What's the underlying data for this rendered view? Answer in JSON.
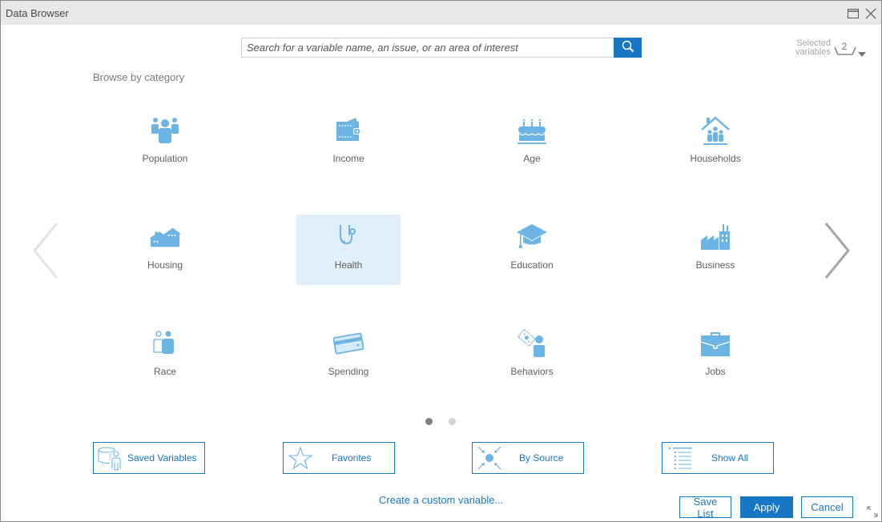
{
  "window": {
    "title": "Data Browser"
  },
  "search": {
    "placeholder": "Search for a variable name, an issue, or an area of interest",
    "value": "",
    "button_icon": "search-icon"
  },
  "selected_variables": {
    "label_line1": "Selected",
    "label_line2": "variables",
    "count": "2"
  },
  "browse": {
    "label": "Browse by category",
    "categories": [
      {
        "label": "Population",
        "icon": "population-icon",
        "selected": false
      },
      {
        "label": "Income",
        "icon": "wallet-icon",
        "selected": false
      },
      {
        "label": "Age",
        "icon": "birthday-cake-icon",
        "selected": false
      },
      {
        "label": "Households",
        "icon": "household-icon",
        "selected": false
      },
      {
        "label": "Housing",
        "icon": "house-icon",
        "selected": false
      },
      {
        "label": "Health",
        "icon": "stethoscope-icon",
        "selected": true
      },
      {
        "label": "Education",
        "icon": "graduation-cap-icon",
        "selected": false
      },
      {
        "label": "Business",
        "icon": "factory-icon",
        "selected": false
      },
      {
        "label": "Race",
        "icon": "people-icon",
        "selected": false
      },
      {
        "label": "Spending",
        "icon": "credit-card-icon",
        "selected": false
      },
      {
        "label": "Behaviors",
        "icon": "behavior-icon",
        "selected": false
      },
      {
        "label": "Jobs",
        "icon": "briefcase-icon",
        "selected": false
      }
    ],
    "pagination": {
      "current_page": 1,
      "total_pages": 2
    }
  },
  "options": [
    {
      "label": "Saved Variables",
      "icon": "saved-variables-icon"
    },
    {
      "label": "Favorites",
      "icon": "star-icon"
    },
    {
      "label": "By Source",
      "icon": "source-icon"
    },
    {
      "label": "Show All",
      "icon": "list-icon"
    }
  ],
  "footer": {
    "custom_link": "Create a custom variable...",
    "save_list": "Save List",
    "apply": "Apply",
    "cancel": "Cancel"
  },
  "colors": {
    "accent": "#1877c5",
    "icon": "#6cb4e4",
    "selected_bg": "#e1effa",
    "titlebar_bg": "#e8e8e8"
  }
}
